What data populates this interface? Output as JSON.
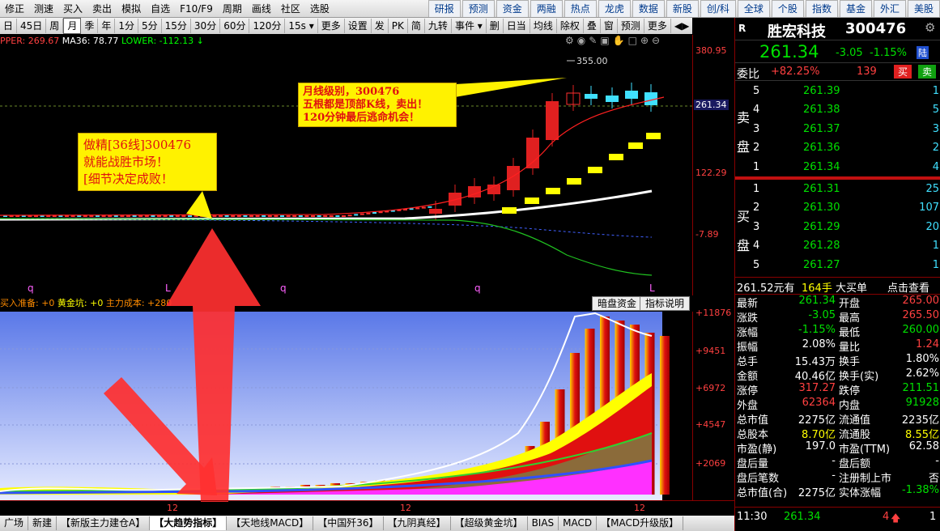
{
  "topmenu": {
    "items": [
      "修正",
      "测速",
      "买入",
      "卖出",
      "模拟",
      "自选",
      "F10/F9",
      "周期",
      "画线",
      "社区",
      "选股"
    ],
    "right": [
      "研报",
      "预测",
      "资金",
      "两融",
      "热点",
      "龙虎",
      "数据",
      "新股",
      "创/科",
      "全球",
      "个股",
      "指数",
      "基金",
      "外汇",
      "美股"
    ]
  },
  "toolbar": {
    "items": [
      "日",
      "45日",
      "周",
      "月",
      "季",
      "年",
      "1分",
      "5分",
      "15分",
      "30分",
      "60分",
      "120分",
      "15s ▾",
      "更多",
      "设置",
      "发",
      "PK",
      "简",
      "九转",
      "事件 ▾",
      "删",
      "日当",
      "均线",
      "除权",
      "叠",
      "窗",
      "预测",
      "更多",
      "◀▶"
    ],
    "selected": "月"
  },
  "indicator1": {
    "upper": "PPER: 269.67",
    "ma": "MA36: 78.77",
    "lower": "LOWER: -112.13 ↓"
  },
  "axis1": {
    "labels": [
      "380.95",
      "122.29",
      "-7.89"
    ],
    "current": "261.34",
    "peak": "355.00"
  },
  "callouts": {
    "left": [
      "做精[36线]300476",
      "就能战胜市场！",
      "[细节决定成败！"
    ],
    "right": [
      "月线级别，300476",
      "五根都是顶部K线，卖出！",
      "120分钟最后逃命机会！"
    ]
  },
  "markers": [
    "q",
    "L",
    "q",
    "q",
    "L"
  ],
  "indicator2": {
    "a": "买入准备: +0",
    "b": "黄金坑: +0",
    "c": "主力成本: +280"
  },
  "buttons": {
    "a": "暗盘资金",
    "b": "指标说明"
  },
  "axis2": {
    "labels": [
      "+11876",
      "+9451",
      "+6972",
      "+4547",
      "+2069"
    ]
  },
  "xaxis": {
    "labels": [
      "12",
      "12",
      "12"
    ]
  },
  "bottomtabs": {
    "items": [
      "广场",
      "新建",
      "【新版主力建仓A】",
      "【大趋势指标】",
      "【天地线MACD】",
      "【中国歼36】",
      "【九阴真经】",
      "【超级黄金坑】",
      "BIAS",
      "MACD",
      "【MACD升级版】"
    ],
    "selected": "【大趋势指标】"
  },
  "stock": {
    "flag": "R",
    "name": "胜宏科技",
    "code": "300476",
    "price": "261.34",
    "change": "-3.05",
    "pct": "-1.15%",
    "tag": "陆"
  },
  "order": {
    "label": "委比",
    "ratio": "+82.25%",
    "diff": "139",
    "sell_btn": "买",
    "buy_btn": "卖"
  },
  "asks": [
    {
      "n": "5",
      "p": "261.39",
      "v": "1"
    },
    {
      "n": "4",
      "p": "261.38",
      "v": "5"
    },
    {
      "n": "3",
      "p": "261.37",
      "v": "3"
    },
    {
      "n": "2",
      "p": "261.36",
      "v": "2"
    },
    {
      "n": "1",
      "p": "261.34",
      "v": "4"
    }
  ],
  "bids": [
    {
      "n": "1",
      "p": "261.31",
      "v": "25"
    },
    {
      "n": "2",
      "p": "261.30",
      "v": "107"
    },
    {
      "n": "3",
      "p": "261.29",
      "v": "20"
    },
    {
      "n": "4",
      "p": "261.28",
      "v": "1"
    },
    {
      "n": "5",
      "p": "261.27",
      "v": "1"
    }
  ],
  "sidelabels": {
    "sell1": "卖",
    "sell2": "盘",
    "buy1": "买",
    "buy2": "盘"
  },
  "bigorder": {
    "price": "261.52元有",
    "qty": "164手",
    "label": "大买单",
    "link": "点击查看"
  },
  "stats": [
    [
      "最新",
      "261.34",
      "开盘",
      "265.00"
    ],
    [
      "涨跌",
      "-3.05",
      "最高",
      "265.50"
    ],
    [
      "涨幅",
      "-1.15%",
      "最低",
      "260.00"
    ],
    [
      "振幅",
      "2.08%",
      "量比",
      "1.24"
    ],
    [
      "总手",
      "15.43万",
      "换手",
      "1.80%"
    ],
    [
      "金额",
      "40.46亿",
      "换手(实)",
      "2.62%"
    ],
    [
      "涨停",
      "317.27",
      "跌停",
      "211.51"
    ],
    [
      "外盘",
      "62364",
      "内盘",
      "91928"
    ],
    [
      "总市值",
      "2275亿",
      "流通值",
      "2235亿"
    ],
    [
      "总股本",
      "8.70亿",
      "流通股",
      "8.55亿"
    ],
    [
      "市盈(静)",
      "197.0",
      "市盈(TTM)",
      "62.58"
    ],
    [
      "盘后量",
      "-",
      "盘后额",
      "-"
    ],
    [
      "盘后笔数",
      "-",
      "注册制上市",
      "否"
    ],
    [
      "总市值(合)",
      "2275亿",
      "实体涨幅",
      "-1.38%"
    ]
  ],
  "tick": {
    "time": "11:30",
    "price": "261.34",
    "vol": "4",
    "arrow": "🡅",
    "v2": "1"
  },
  "colors": {
    "up": "#ff4040",
    "down": "#00e000",
    "bg": "#000000",
    "callout": "#fff200"
  }
}
